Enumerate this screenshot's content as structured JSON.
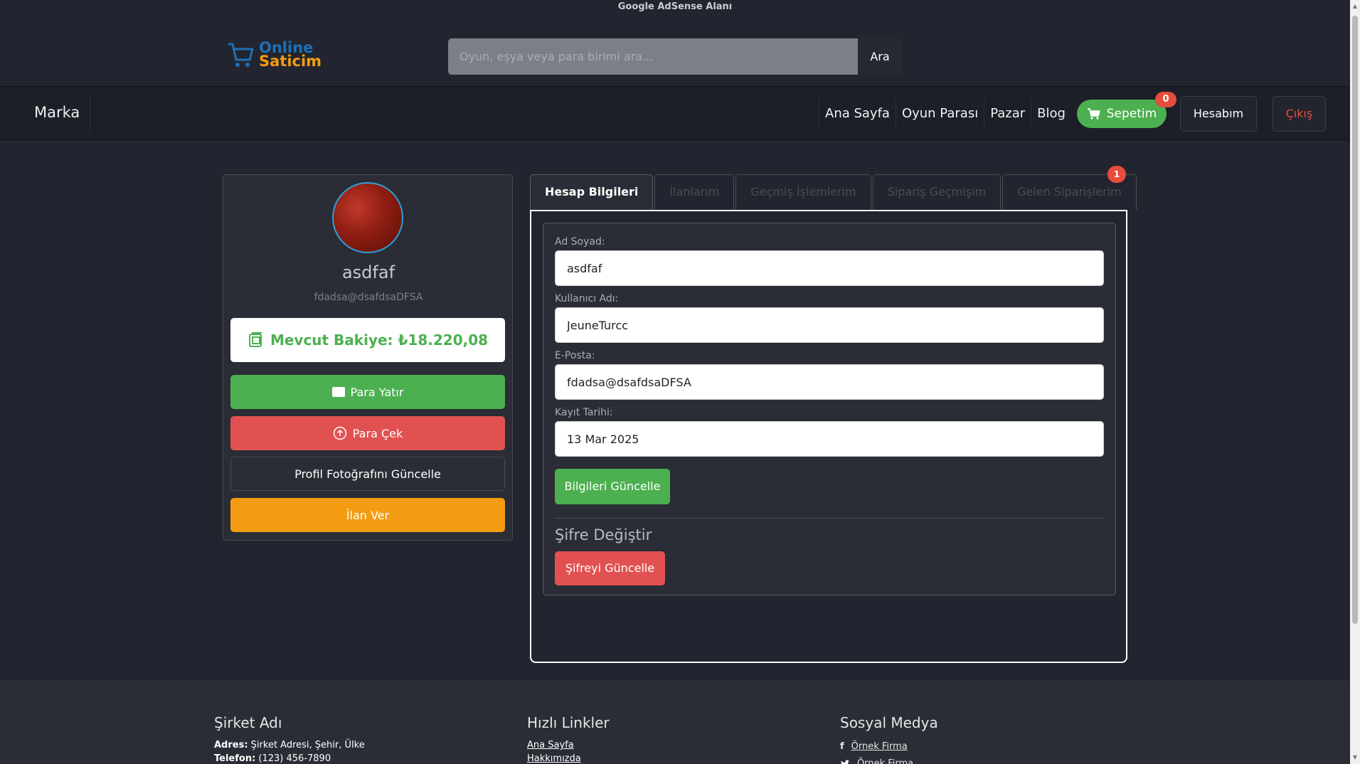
{
  "ad": {
    "label": "Google AdSense Alanı"
  },
  "header": {
    "logo_top": "Online",
    "logo_bottom": "Saticim",
    "search_placeholder": "Oyun, eşya veya para birimi ara...",
    "search_button": "Ara"
  },
  "navbar": {
    "brand": "Marka",
    "links": [
      "Ana Sayfa",
      "Oyun Parası",
      "Pazar",
      "Blog"
    ],
    "cart_label": "Sepetim",
    "cart_count": "0",
    "account_label": "Hesabım",
    "logout_label": "Çıkış"
  },
  "profile": {
    "name": "asdfaf",
    "email": "fdadsa@dsafdsaDFSA",
    "balance": "Mevcut Bakiye: ₺18.220,08",
    "deposit_label": "Para Yatır",
    "withdraw_label": "Para Çek",
    "update_photo_label": "Profil Fotoğrafını Güncelle",
    "post_ad_label": "İlan Ver"
  },
  "tabs": {
    "items": [
      "Hesap Bilgileri",
      "İlanlarım",
      "Geçmiş İşlemlerim",
      "Sipariş Geçmişim",
      "Gelen Siparişlerim"
    ],
    "active": "Hesap Bilgileri",
    "incoming_badge": "1"
  },
  "account_form": {
    "full_name_label": "Ad Soyad:",
    "full_name_value": "asdfaf",
    "username_label": "Kullanıcı Adı:",
    "username_value": "JeuneTurcc",
    "email_label": "E-Posta:",
    "email_value": "fdadsa@dsafdsaDFSA",
    "register_date_label": "Kayıt Tarihi:",
    "register_date_value": "13 Mar 2025",
    "update_button": "Bilgileri Güncelle",
    "password_title": "Şifre Değiştir",
    "password_button": "Şifreyi Güncelle"
  },
  "footer": {
    "company_title": "Şirket Adı",
    "address_label": "Adres:",
    "address_value": "Şirket Adresi, Şehir, Ülke",
    "phone_label": "Telefon:",
    "phone_value": "(123) 456-7890",
    "quick_links_title": "Hızlı Linkler",
    "quick_links": [
      "Ana Sayfa",
      "Hakkımızda"
    ],
    "social_title": "Sosyal Medya",
    "social_links": [
      "Örnek Firma",
      "Örnek Firma"
    ]
  },
  "colors": {
    "background": "#22252f",
    "green": "#4cb050",
    "red": "#e15151",
    "orange": "#f39c12",
    "badge": "#e74c3c"
  }
}
